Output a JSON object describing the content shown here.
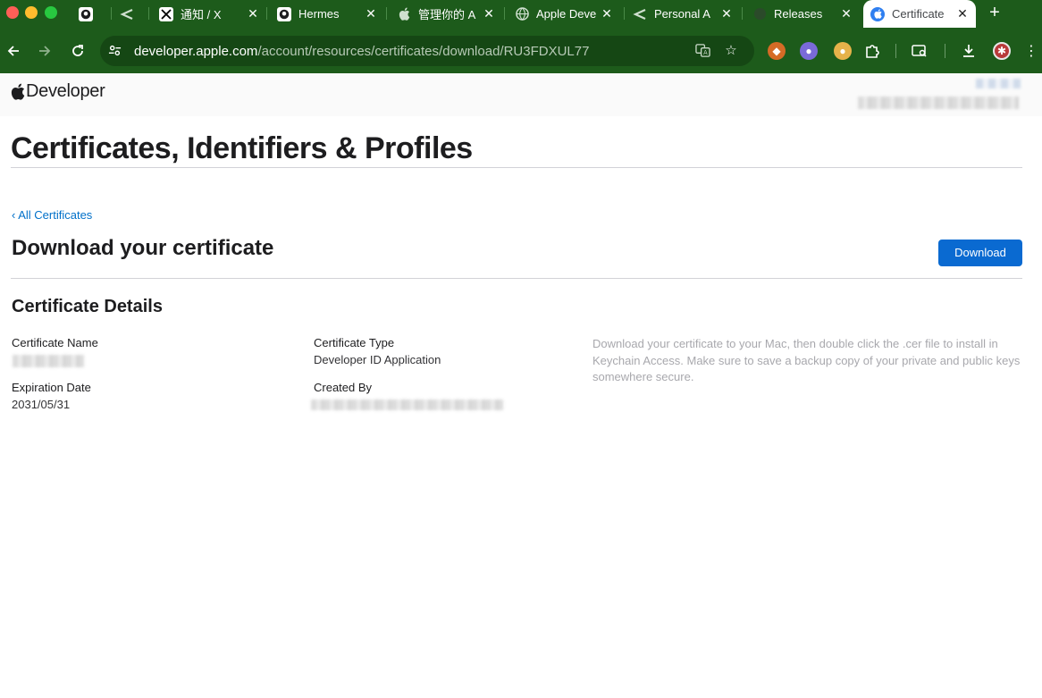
{
  "browser": {
    "tabs": [
      {
        "title": "",
        "icon": "github-icon"
      },
      {
        "title": "",
        "icon": "layer-icon"
      },
      {
        "title": "通知 / X",
        "icon": "x-icon"
      },
      {
        "title": "Hermes",
        "icon": "github-icon"
      },
      {
        "title": "管理你的 A",
        "icon": "apple-icon"
      },
      {
        "title": "Apple Deve",
        "icon": "globe-icon"
      },
      {
        "title": "Personal A",
        "icon": "layer-icon"
      },
      {
        "title": "Releases",
        "icon": "github-icon"
      },
      {
        "title": "Certificate",
        "icon": "apple-icon",
        "active": true
      }
    ],
    "url": {
      "host": "developer.apple.com",
      "path": "/account/resources/certificates/download/RU3FDXUL77"
    },
    "colors": {
      "chrome": "#1d5b1b",
      "omnibox": "#154714"
    }
  },
  "header": {
    "logo_text": "Developer"
  },
  "page": {
    "title": "Certificates, Identifiers & Profiles",
    "back_link": "‹ All Certificates",
    "heading": "Download your certificate",
    "download_label": "Download",
    "details_title": "Certificate Details",
    "fields": {
      "cert_name_label": "Certificate Name",
      "cert_type_label": "Certificate Type",
      "cert_type_value": "Developer ID Application",
      "expiration_label": "Expiration Date",
      "expiration_value": "2031/05/31",
      "created_by_label": "Created By"
    },
    "hint": "Download your certificate to your Mac, then double click the .cer file to install in Keychain Access. Make sure to save a backup copy of your private and public keys somewhere secure.",
    "colors": {
      "link": "#0070c9",
      "button": "#0a6ad1",
      "hint": "#a8a8ad"
    }
  }
}
